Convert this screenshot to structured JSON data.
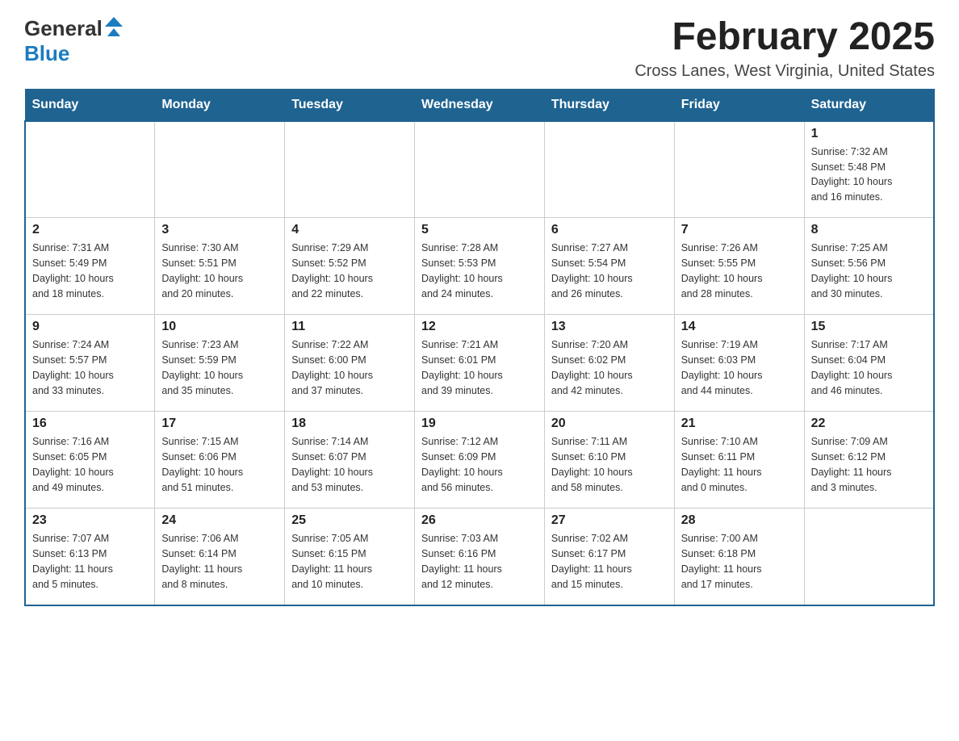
{
  "header": {
    "logo_general": "General",
    "logo_blue": "Blue",
    "title": "February 2025",
    "subtitle": "Cross Lanes, West Virginia, United States"
  },
  "days_of_week": [
    "Sunday",
    "Monday",
    "Tuesday",
    "Wednesday",
    "Thursday",
    "Friday",
    "Saturday"
  ],
  "weeks": [
    [
      {
        "day": "",
        "info": ""
      },
      {
        "day": "",
        "info": ""
      },
      {
        "day": "",
        "info": ""
      },
      {
        "day": "",
        "info": ""
      },
      {
        "day": "",
        "info": ""
      },
      {
        "day": "",
        "info": ""
      },
      {
        "day": "1",
        "info": "Sunrise: 7:32 AM\nSunset: 5:48 PM\nDaylight: 10 hours\nand 16 minutes."
      }
    ],
    [
      {
        "day": "2",
        "info": "Sunrise: 7:31 AM\nSunset: 5:49 PM\nDaylight: 10 hours\nand 18 minutes."
      },
      {
        "day": "3",
        "info": "Sunrise: 7:30 AM\nSunset: 5:51 PM\nDaylight: 10 hours\nand 20 minutes."
      },
      {
        "day": "4",
        "info": "Sunrise: 7:29 AM\nSunset: 5:52 PM\nDaylight: 10 hours\nand 22 minutes."
      },
      {
        "day": "5",
        "info": "Sunrise: 7:28 AM\nSunset: 5:53 PM\nDaylight: 10 hours\nand 24 minutes."
      },
      {
        "day": "6",
        "info": "Sunrise: 7:27 AM\nSunset: 5:54 PM\nDaylight: 10 hours\nand 26 minutes."
      },
      {
        "day": "7",
        "info": "Sunrise: 7:26 AM\nSunset: 5:55 PM\nDaylight: 10 hours\nand 28 minutes."
      },
      {
        "day": "8",
        "info": "Sunrise: 7:25 AM\nSunset: 5:56 PM\nDaylight: 10 hours\nand 30 minutes."
      }
    ],
    [
      {
        "day": "9",
        "info": "Sunrise: 7:24 AM\nSunset: 5:57 PM\nDaylight: 10 hours\nand 33 minutes."
      },
      {
        "day": "10",
        "info": "Sunrise: 7:23 AM\nSunset: 5:59 PM\nDaylight: 10 hours\nand 35 minutes."
      },
      {
        "day": "11",
        "info": "Sunrise: 7:22 AM\nSunset: 6:00 PM\nDaylight: 10 hours\nand 37 minutes."
      },
      {
        "day": "12",
        "info": "Sunrise: 7:21 AM\nSunset: 6:01 PM\nDaylight: 10 hours\nand 39 minutes."
      },
      {
        "day": "13",
        "info": "Sunrise: 7:20 AM\nSunset: 6:02 PM\nDaylight: 10 hours\nand 42 minutes."
      },
      {
        "day": "14",
        "info": "Sunrise: 7:19 AM\nSunset: 6:03 PM\nDaylight: 10 hours\nand 44 minutes."
      },
      {
        "day": "15",
        "info": "Sunrise: 7:17 AM\nSunset: 6:04 PM\nDaylight: 10 hours\nand 46 minutes."
      }
    ],
    [
      {
        "day": "16",
        "info": "Sunrise: 7:16 AM\nSunset: 6:05 PM\nDaylight: 10 hours\nand 49 minutes."
      },
      {
        "day": "17",
        "info": "Sunrise: 7:15 AM\nSunset: 6:06 PM\nDaylight: 10 hours\nand 51 minutes."
      },
      {
        "day": "18",
        "info": "Sunrise: 7:14 AM\nSunset: 6:07 PM\nDaylight: 10 hours\nand 53 minutes."
      },
      {
        "day": "19",
        "info": "Sunrise: 7:12 AM\nSunset: 6:09 PM\nDaylight: 10 hours\nand 56 minutes."
      },
      {
        "day": "20",
        "info": "Sunrise: 7:11 AM\nSunset: 6:10 PM\nDaylight: 10 hours\nand 58 minutes."
      },
      {
        "day": "21",
        "info": "Sunrise: 7:10 AM\nSunset: 6:11 PM\nDaylight: 11 hours\nand 0 minutes."
      },
      {
        "day": "22",
        "info": "Sunrise: 7:09 AM\nSunset: 6:12 PM\nDaylight: 11 hours\nand 3 minutes."
      }
    ],
    [
      {
        "day": "23",
        "info": "Sunrise: 7:07 AM\nSunset: 6:13 PM\nDaylight: 11 hours\nand 5 minutes."
      },
      {
        "day": "24",
        "info": "Sunrise: 7:06 AM\nSunset: 6:14 PM\nDaylight: 11 hours\nand 8 minutes."
      },
      {
        "day": "25",
        "info": "Sunrise: 7:05 AM\nSunset: 6:15 PM\nDaylight: 11 hours\nand 10 minutes."
      },
      {
        "day": "26",
        "info": "Sunrise: 7:03 AM\nSunset: 6:16 PM\nDaylight: 11 hours\nand 12 minutes."
      },
      {
        "day": "27",
        "info": "Sunrise: 7:02 AM\nSunset: 6:17 PM\nDaylight: 11 hours\nand 15 minutes."
      },
      {
        "day": "28",
        "info": "Sunrise: 7:00 AM\nSunset: 6:18 PM\nDaylight: 11 hours\nand 17 minutes."
      },
      {
        "day": "",
        "info": ""
      }
    ]
  ]
}
